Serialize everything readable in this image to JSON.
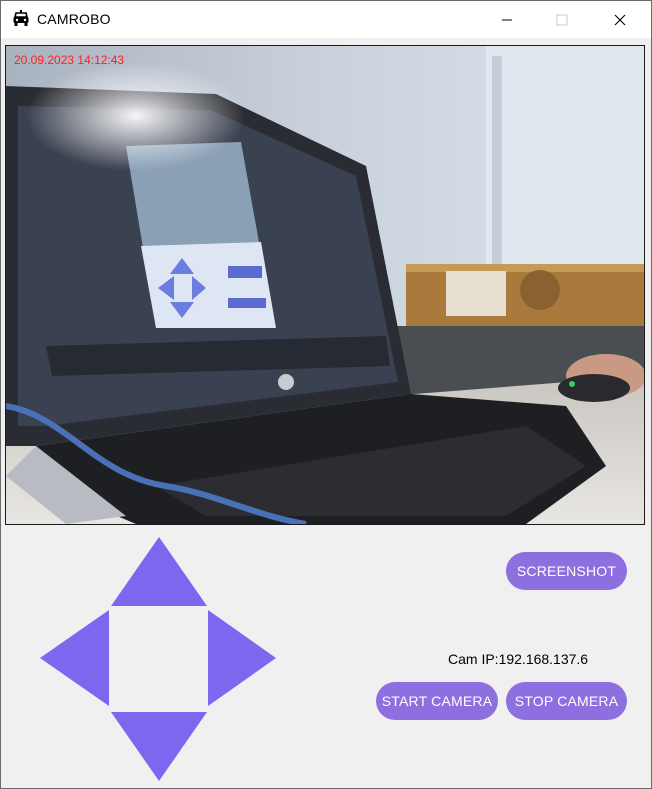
{
  "window": {
    "title": "CAMROBO",
    "app_icon": "robot-car-icon",
    "controls": [
      "minimize-icon",
      "maximize-icon",
      "close-icon"
    ]
  },
  "camera_view": {
    "timestamp": "20.09.2023 14:12:43",
    "timestamp_color": "#ff2020"
  },
  "dpad": {
    "color": "#7b68ee",
    "directions": [
      "up",
      "left",
      "right",
      "down"
    ]
  },
  "buttons": {
    "screenshot": "SCREENSHOT",
    "start_camera": "START CAMERA",
    "stop_camera": "STOP CAMERA"
  },
  "status": {
    "cam_ip": "Cam IP:192.168.137.6"
  },
  "colors": {
    "button_bg": "#8e6fe0",
    "button_text": "#ffffff",
    "window_bg": "#f0f0f0"
  }
}
